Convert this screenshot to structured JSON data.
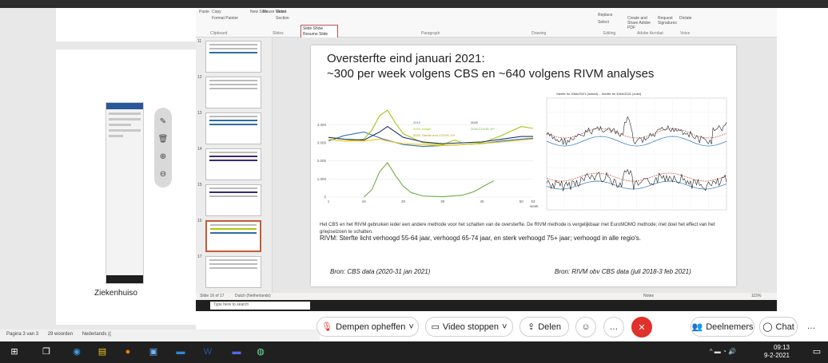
{
  "word": {
    "caption": "Ziekenhuiso",
    "status": {
      "pages": "Pagina 3 van 3",
      "words": "29 woorden",
      "language": "Nederlands (("
    }
  },
  "ppt": {
    "ribbon": {
      "clipboard_label": "Clipboard",
      "slides_label": "Slides",
      "paragraph_label": "Paragraph",
      "drawing_label": "Drawing",
      "editing_label": "Editing",
      "adobe_label": "Adobe Acrobat",
      "voice_label": "Voice",
      "paste": "Paste",
      "copy": "Copy",
      "format_painter": "Format Painter",
      "new_slide": "New Slide",
      "reuse_slides": "Reuse Slides",
      "reset": "Reset",
      "section": "Section",
      "replace": "Replace",
      "select": "Select",
      "create_share_pdf": "Create and Share Adobe PDF",
      "request_signatures": "Request Signatures",
      "dictate": "Dictate",
      "tooltip_line1": "Slide Show",
      "tooltip_line2": "Resume Slide Show"
    },
    "thumbnails": [
      {
        "num": "11"
      },
      {
        "num": "12"
      },
      {
        "num": "13"
      },
      {
        "num": "14"
      },
      {
        "num": "15"
      },
      {
        "num": "16"
      },
      {
        "num": "17"
      }
    ],
    "slide": {
      "title_line1": "Oversterfte eind januari 2021:",
      "title_line2": "~300 per week volgens CBS en ~640 volgens RIVM analyses",
      "body_text": "Het CBS en het RIVM gebruiken ieder een andere methode voor het schatten van de oversterfte. De RIVM methode is vergelijkbaar met EuroMOMO methode; met doel het effect van het griepseizoen te schatten.",
      "rivm_text": "RIVM: Sterfte licht verhoogd 55-64 jaar, verhoogd 65-74 jaar, en sterk verhoogd 75+ jaar; verhoogd in alle regio's.",
      "source_left": "Bron: CBS data (2020-31 jan 2021)",
      "source_right": "Bron: RIVM obv CBS data (juli 2018-3 feb 2021)"
    },
    "status": {
      "slide_of": "Slide 16 of 17",
      "language": "Dutch (Netherlands)",
      "notes": "Notes",
      "zoom": "115%"
    },
    "taskbar": {
      "search_placeholder": "Type here to search"
    }
  },
  "zoom_controls": {
    "unmute": "Dempen opheffen",
    "stop_video": "Video stoppen",
    "share": "Delen",
    "participants": "Deelnemers",
    "chat": "Chat"
  },
  "taskbar": {
    "time": "09:13",
    "date": "9-2-2021"
  },
  "chart_data": [
    {
      "type": "line",
      "title": "",
      "xlabel": "week",
      "ylabel": "",
      "xlim": [
        1,
        53
      ],
      "ylim": [
        0,
        4500
      ],
      "x_ticks": [
        1,
        10,
        20,
        30,
        40,
        50,
        53
      ],
      "y_ticks": [
        0,
        1000,
        2000,
        3000,
        4000
      ],
      "legend": [
        "2019",
        "2020, totaal*",
        "2020, Sterfte excl COVID-19*",
        "2020",
        "2020 COVID-19*"
      ],
      "series": [
        {
          "name": "2019",
          "color": "#2e75b6",
          "x": [
            1,
            5,
            10,
            15,
            20,
            25,
            30,
            35,
            40,
            45,
            50,
            53
          ],
          "y": [
            3100,
            3400,
            3600,
            3200,
            2900,
            2800,
            2850,
            2900,
            2950,
            3100,
            3200,
            3250
          ]
        },
        {
          "name": "2020, totaal*",
          "color": "#a9c70d",
          "x": [
            1,
            5,
            10,
            12,
            14,
            16,
            18,
            20,
            25,
            30,
            33,
            35,
            40,
            45,
            50,
            53
          ],
          "y": [
            3200,
            3100,
            3200,
            3700,
            4500,
            4800,
            4100,
            3500,
            3000,
            2900,
            3150,
            3000,
            3000,
            3400,
            3900,
            3800
          ]
        },
        {
          "name": "2020, Sterfte excl COVID-19*",
          "color": "#f0c419",
          "x": [
            1,
            5,
            10,
            14,
            16,
            20,
            25,
            30,
            35,
            40,
            45,
            50,
            53
          ],
          "y": [
            3200,
            3100,
            3100,
            3200,
            3100,
            2950,
            2900,
            2850,
            2900,
            2950,
            3050,
            3150,
            3200
          ]
        },
        {
          "name": "2020",
          "color": "#1f3864",
          "x": [
            1,
            5,
            10,
            14,
            16,
            20,
            25,
            30,
            35,
            40,
            45,
            50,
            53
          ],
          "y": [
            3300,
            3200,
            3150,
            3600,
            3900,
            3300,
            3050,
            2950,
            3000,
            3050,
            3200,
            3350,
            3350
          ]
        },
        {
          "name": "2020 COVID-19*",
          "color": "#70ad47",
          "x": [
            10,
            12,
            14,
            16,
            18,
            20,
            22,
            25,
            30,
            35,
            38,
            40,
            43
          ],
          "y": [
            0,
            400,
            1400,
            1900,
            1200,
            600,
            250,
            60,
            20,
            100,
            300,
            550,
            900
          ]
        }
      ]
    },
    {
      "type": "line",
      "title": "Sterfte tm 3/feb/2021 (dotted) – Sterfte tm 3/feb/2021 (solid)",
      "xlabel": "",
      "ylabel": "",
      "note": "RIVM mortality monitoring chart, total deaths vs. expected range (upper and lower series)"
    }
  ]
}
